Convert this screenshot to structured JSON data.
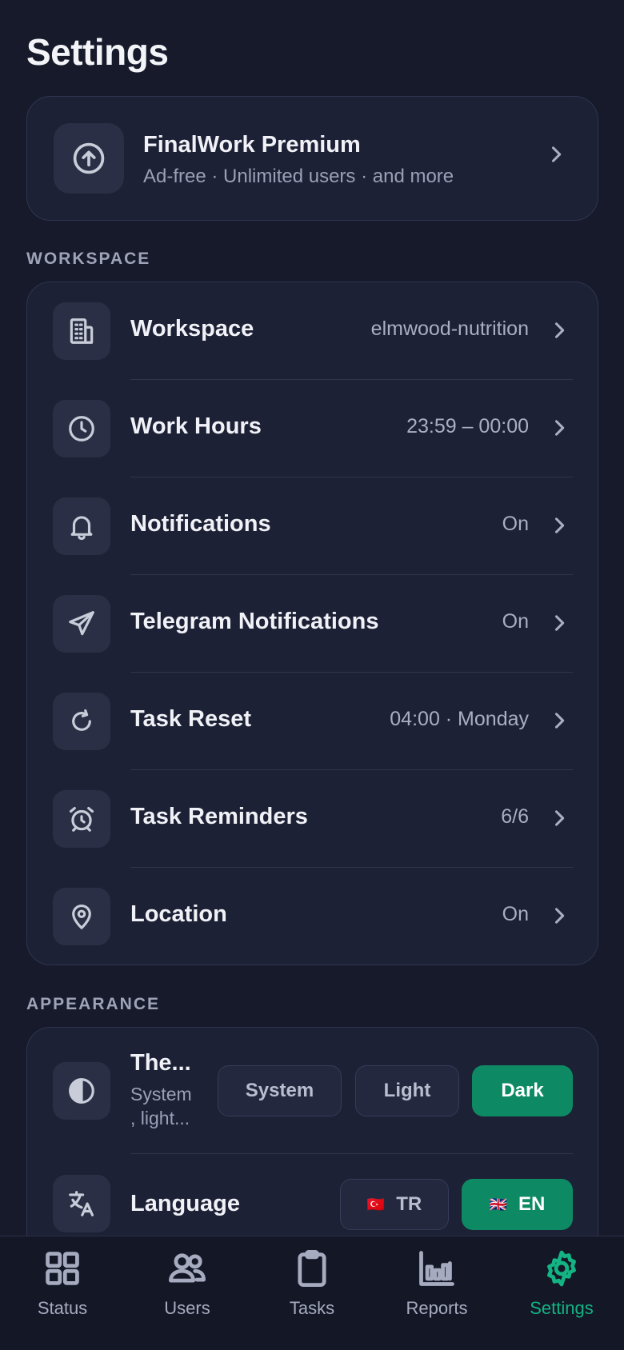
{
  "page": {
    "title": "Settings"
  },
  "premium": {
    "title": "FinalWork Premium",
    "subtitle": "Ad-free · Unlimited users · and more",
    "icon": "arrow-up-circle-icon"
  },
  "sections": {
    "workspace": "WORKSPACE",
    "appearance": "APPEARANCE"
  },
  "workspace_rows": [
    {
      "label": "Workspace",
      "value": "elmwood-nutrition",
      "icon": "building-icon"
    },
    {
      "label": "Work Hours",
      "value": "23:59 – 00:00",
      "icon": "clock-icon"
    },
    {
      "label": "Notifications",
      "value": "On",
      "icon": "bell-icon"
    },
    {
      "label": "Telegram Notifications",
      "value": "On",
      "icon": "send-icon"
    },
    {
      "label": "Task Reset",
      "value": "04:00 · Monday",
      "icon": "refresh-icon"
    },
    {
      "label": "Task Reminders",
      "value": "6/6",
      "icon": "alarm-clock-icon"
    },
    {
      "label": "Location",
      "value": "On",
      "icon": "map-pin-icon"
    }
  ],
  "appearance": {
    "theme": {
      "label": "The...",
      "description_line1": "System",
      "description_line2": ", light...",
      "icon": "contrast-icon",
      "options": [
        "System",
        "Light",
        "Dark"
      ],
      "selected": "Dark"
    },
    "language": {
      "label": "Language",
      "icon": "translate-icon",
      "options": [
        {
          "flag": "🇹🇷",
          "code": "TR"
        },
        {
          "flag": "🇬🇧",
          "code": "EN"
        }
      ],
      "selected": "EN"
    }
  },
  "tabbar": {
    "items": [
      {
        "label": "Status",
        "icon": "grid-icon"
      },
      {
        "label": "Users",
        "icon": "users-icon"
      },
      {
        "label": "Tasks",
        "icon": "clipboard-icon"
      },
      {
        "label": "Reports",
        "icon": "bar-chart-icon"
      },
      {
        "label": "Settings",
        "icon": "gear-icon"
      }
    ],
    "active": "Settings",
    "active_color": "#14b383"
  },
  "colors": {
    "background": "#161a2b",
    "card": "#1d2135",
    "accent": "#0d8a64"
  }
}
